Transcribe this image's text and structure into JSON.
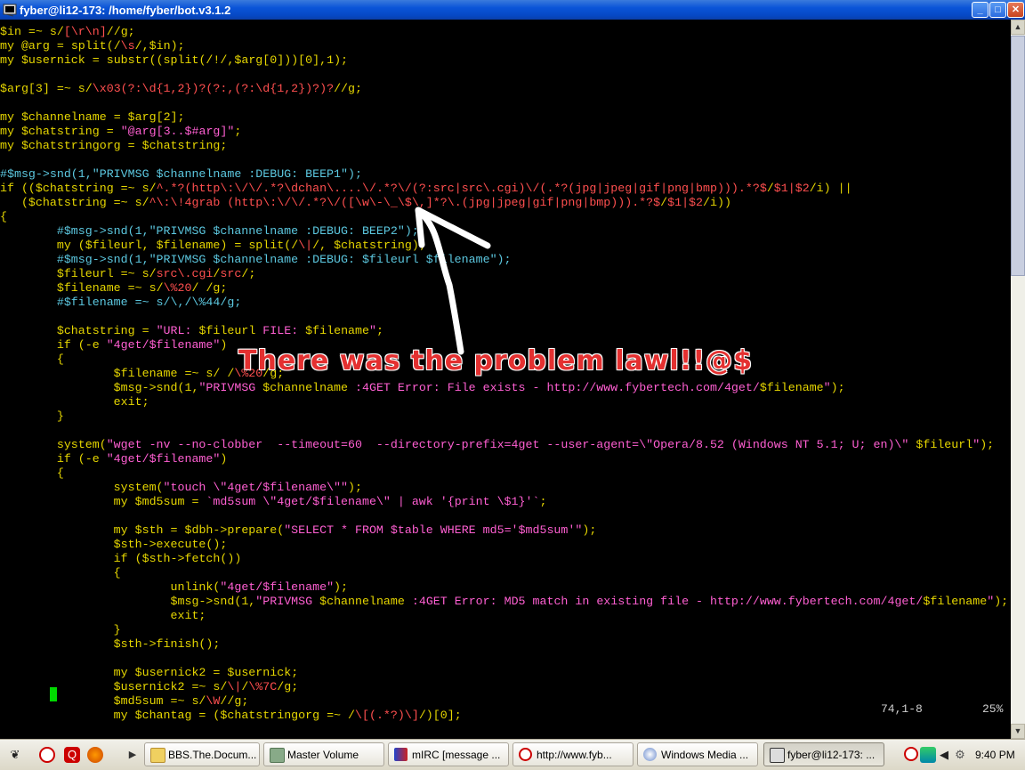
{
  "window": {
    "title": "fyber@li12-173: /home/fyber/bot.v3.1.2",
    "buttons": {
      "minimize": "_",
      "maximize": "□",
      "close": "✕"
    }
  },
  "code_lines": [
    [
      [
        "v",
        "$in"
      ],
      [
        "k",
        " =~ s/"
      ],
      [
        "r",
        "[\\r\\n]"
      ],
      [
        "k",
        "//g;"
      ]
    ],
    [
      [
        "k",
        "my "
      ],
      [
        "v",
        "@arg"
      ],
      [
        "k",
        " = split(/"
      ],
      [
        "r",
        "\\s"
      ],
      [
        "k",
        "/,"
      ],
      [
        "v",
        "$in"
      ],
      [
        "k",
        ");"
      ]
    ],
    [
      [
        "k",
        "my "
      ],
      [
        "v",
        "$usernick"
      ],
      [
        "k",
        " = substr((split(/!/,"
      ],
      [
        "v",
        "$arg"
      ],
      [
        "k",
        "[0]))[0],1);"
      ]
    ],
    [
      [
        "k",
        ""
      ]
    ],
    [
      [
        "v",
        "$arg"
      ],
      [
        "k",
        "[3] =~ s/"
      ],
      [
        "r",
        "\\x03(?:\\d{1,2})?(?:,(?:\\d{1,2})?)?"
      ],
      [
        "k",
        "//g;"
      ]
    ],
    [
      [
        "k",
        ""
      ]
    ],
    [
      [
        "k",
        "my "
      ],
      [
        "v",
        "$channelname"
      ],
      [
        "k",
        " = "
      ],
      [
        "v",
        "$arg"
      ],
      [
        "k",
        "[2];"
      ]
    ],
    [
      [
        "k",
        "my "
      ],
      [
        "v",
        "$chatstring"
      ],
      [
        "k",
        " = "
      ],
      [
        "s",
        "\"@arg[3..$#arg]\""
      ],
      [
        "k",
        ";"
      ]
    ],
    [
      [
        "k",
        "my "
      ],
      [
        "v",
        "$chatstringorg"
      ],
      [
        "k",
        " = "
      ],
      [
        "v",
        "$chatstring"
      ],
      [
        "k",
        ";"
      ]
    ],
    [
      [
        "k",
        ""
      ]
    ],
    [
      [
        "c",
        "#$msg->snd(1,\"PRIVMSG $channelname :DEBUG: BEEP1\");"
      ]
    ],
    [
      [
        "k",
        "if (("
      ],
      [
        "v",
        "$chatstring"
      ],
      [
        "k",
        " =~ s/"
      ],
      [
        "r",
        "^.*?(http\\:\\/\\/.*?\\dchan\\....\\/.*?\\/(?:src|src\\.cgi)\\/(.*?(jpg|jpeg|gif|png|bmp))).*?$"
      ],
      [
        "k",
        "/"
      ],
      [
        "r",
        "$1|$2"
      ],
      [
        "k",
        "/i) ||"
      ]
    ],
    [
      [
        "k",
        "   ("
      ],
      [
        "v",
        "$chatstring"
      ],
      [
        "k",
        " =~ s/"
      ],
      [
        "r",
        "^\\:\\!4grab (http\\:\\/\\/.*?\\/([\\w\\-\\_\\$\\,]*?\\.(jpg|jpeg|gif|png|bmp))).*?$"
      ],
      [
        "k",
        "/"
      ],
      [
        "r",
        "$1|$2"
      ],
      [
        "k",
        "/i))"
      ]
    ],
    [
      [
        "k",
        "{"
      ]
    ],
    [
      [
        "c",
        "        #$msg->snd(1,\"PRIVMSG $channelname :DEBUG: BEEP2\");"
      ]
    ],
    [
      [
        "k",
        "        my ("
      ],
      [
        "v",
        "$fileurl"
      ],
      [
        "k",
        ", "
      ],
      [
        "v",
        "$filename"
      ],
      [
        "k",
        ") = split(/"
      ],
      [
        "r",
        "\\|"
      ],
      [
        "k",
        "/, "
      ],
      [
        "v",
        "$chatstring"
      ],
      [
        "k",
        ");"
      ]
    ],
    [
      [
        "c",
        "        #$msg->snd(1,\"PRIVMSG $channelname :DEBUG: $fileurl $filename\");"
      ]
    ],
    [
      [
        "k",
        "        "
      ],
      [
        "v",
        "$fileurl"
      ],
      [
        "k",
        " =~ s/"
      ],
      [
        "r",
        "src\\.cgi"
      ],
      [
        "k",
        "/"
      ],
      [
        "r",
        "src"
      ],
      [
        "k",
        "/;"
      ]
    ],
    [
      [
        "k",
        "        "
      ],
      [
        "v",
        "$filename"
      ],
      [
        "k",
        " =~ s/"
      ],
      [
        "r",
        "\\%20"
      ],
      [
        "k",
        "/ /g;"
      ]
    ],
    [
      [
        "c",
        "        #$filename =~ s/\\,/\\%44/g;"
      ]
    ],
    [
      [
        "k",
        ""
      ]
    ],
    [
      [
        "k",
        "        "
      ],
      [
        "v",
        "$chatstring"
      ],
      [
        "k",
        " = "
      ],
      [
        "s",
        "\"URL: "
      ],
      [
        "v",
        "$fileurl"
      ],
      [
        "s",
        " FILE: "
      ],
      [
        "v",
        "$filename"
      ],
      [
        "s",
        "\""
      ],
      [
        "k",
        ";"
      ]
    ],
    [
      [
        "k",
        "        if (-e "
      ],
      [
        "s",
        "\"4get/$filename\""
      ],
      [
        "k",
        ")"
      ]
    ],
    [
      [
        "k",
        "        {"
      ]
    ],
    [
      [
        "k",
        "                "
      ],
      [
        "v",
        "$filename"
      ],
      [
        "k",
        " =~ s/ /"
      ],
      [
        "r",
        "\\%20"
      ],
      [
        "k",
        "/g;"
      ]
    ],
    [
      [
        "k",
        "                "
      ],
      [
        "v",
        "$msg"
      ],
      [
        "k",
        "->snd(1,"
      ],
      [
        "s",
        "\"PRIVMSG "
      ],
      [
        "v",
        "$channelname"
      ],
      [
        "s",
        " :4GET Error: File exists - http://www.fybertech.com/4get/"
      ],
      [
        "v",
        "$filename"
      ],
      [
        "s",
        "\""
      ],
      [
        "k",
        ");"
      ]
    ],
    [
      [
        "k",
        "                exit;"
      ]
    ],
    [
      [
        "k",
        "        }"
      ]
    ],
    [
      [
        "k",
        ""
      ]
    ],
    [
      [
        "k",
        "        system("
      ],
      [
        "s",
        "\"wget -nv --no-clobber  --timeout=60  --directory-prefix=4get --user-agent=\\\"Opera/8.52 (Windows NT 5.1; U; en)\\\" "
      ],
      [
        "v",
        "$fileurl"
      ],
      [
        "s",
        "\""
      ],
      [
        "k",
        ");"
      ]
    ],
    [
      [
        "k",
        "        if (-e "
      ],
      [
        "s",
        "\"4get/$filename\""
      ],
      [
        "k",
        ")"
      ]
    ],
    [
      [
        "k",
        "        {"
      ]
    ],
    [
      [
        "k",
        "                system("
      ],
      [
        "s",
        "\"touch \\\"4get/$filename\\\"\""
      ],
      [
        "k",
        ");"
      ]
    ],
    [
      [
        "k",
        "                my "
      ],
      [
        "v",
        "$md5sum"
      ],
      [
        "k",
        " = "
      ],
      [
        "s",
        "`md5sum \\\"4get/$filename\\\" | awk '{print \\$1}'`"
      ],
      [
        "k",
        ";"
      ]
    ],
    [
      [
        "k",
        ""
      ]
    ],
    [
      [
        "k",
        "                my "
      ],
      [
        "v",
        "$sth"
      ],
      [
        "k",
        " = "
      ],
      [
        "v",
        "$dbh"
      ],
      [
        "k",
        "->prepare("
      ],
      [
        "s",
        "\"SELECT * FROM $table WHERE md5='$md5sum'\""
      ],
      [
        "k",
        ");"
      ]
    ],
    [
      [
        "k",
        "                "
      ],
      [
        "v",
        "$sth"
      ],
      [
        "k",
        "->execute();"
      ]
    ],
    [
      [
        "k",
        "                if ("
      ],
      [
        "v",
        "$sth"
      ],
      [
        "k",
        "->fetch())"
      ]
    ],
    [
      [
        "k",
        "                {"
      ]
    ],
    [
      [
        "k",
        "                        unlink("
      ],
      [
        "s",
        "\"4get/$filename\""
      ],
      [
        "k",
        ");"
      ]
    ],
    [
      [
        "k",
        "                        "
      ],
      [
        "v",
        "$msg"
      ],
      [
        "k",
        "->snd(1,"
      ],
      [
        "s",
        "\"PRIVMSG "
      ],
      [
        "v",
        "$channelname"
      ],
      [
        "s",
        " :4GET Error: MD5 match in existing file - http://www.fybertech.com/4get/"
      ],
      [
        "v",
        "$filename"
      ],
      [
        "s",
        "\""
      ],
      [
        "k",
        ");"
      ]
    ],
    [
      [
        "k",
        "                        exit;"
      ]
    ],
    [
      [
        "k",
        "                }"
      ]
    ],
    [
      [
        "k",
        "                "
      ],
      [
        "v",
        "$sth"
      ],
      [
        "k",
        "->finish();"
      ]
    ],
    [
      [
        "k",
        ""
      ]
    ],
    [
      [
        "k",
        "                my "
      ],
      [
        "v",
        "$usernick2"
      ],
      [
        "k",
        " = "
      ],
      [
        "v",
        "$usernick"
      ],
      [
        "k",
        ";"
      ]
    ],
    [
      [
        "k",
        "                "
      ],
      [
        "v",
        "$usernick2"
      ],
      [
        "k",
        " =~ s/"
      ],
      [
        "r",
        "\\|"
      ],
      [
        "k",
        "/"
      ],
      [
        "r",
        "\\%7C"
      ],
      [
        "k",
        "/g;"
      ]
    ],
    [
      [
        "k",
        "                "
      ],
      [
        "v",
        "$md5sum"
      ],
      [
        "k",
        " =~ s/"
      ],
      [
        "r",
        "\\W"
      ],
      [
        "k",
        "//g;"
      ]
    ],
    [
      [
        "k",
        "                my "
      ],
      [
        "v",
        "$chantag"
      ],
      [
        "k",
        " = ("
      ],
      [
        "v",
        "$chatstringorg"
      ],
      [
        "k",
        " =~ /"
      ],
      [
        "r",
        "\\[(.*?)\\]"
      ],
      [
        "k",
        "/)[0];"
      ]
    ]
  ],
  "status": {
    "position": "74,1-8",
    "percent": "25%"
  },
  "annotation": {
    "text": "There was the problem lawl!!@$"
  },
  "taskbar": {
    "tasks": [
      {
        "label": "BBS.The.Docum...",
        "icon": "folder-icon",
        "active": false
      },
      {
        "label": "Master Volume",
        "icon": "speaker-icon",
        "active": false
      },
      {
        "label": "mIRC [message ...",
        "icon": "mirc-icon",
        "active": false
      },
      {
        "label": "http://www.fyb...",
        "icon": "opera-icon",
        "active": false
      },
      {
        "label": "Windows Media ...",
        "icon": "media-player-icon",
        "active": false
      },
      {
        "label": "fyber@li12-173: ...",
        "icon": "putty-icon",
        "active": true
      }
    ],
    "clock": "9:40 PM"
  },
  "colors": {
    "titlebar": "#0a54d8",
    "variable": "#e6d600",
    "string": "#ff5fd2",
    "regex": "#ff4f4f",
    "comment": "#5cc8e0",
    "cursor": "#00d800"
  }
}
